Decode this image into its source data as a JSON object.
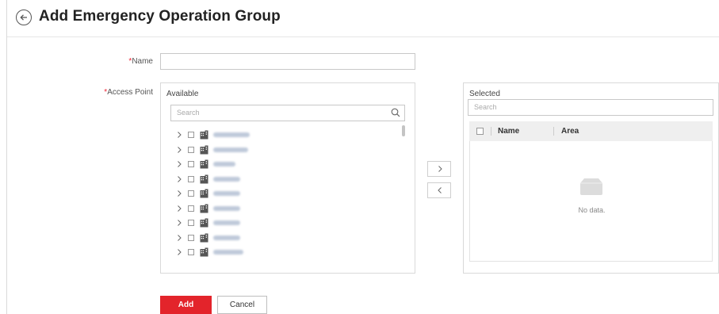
{
  "header": {
    "back_icon": "arrow-left-circle-icon",
    "title": "Add Emergency Operation Group"
  },
  "form": {
    "name_label": "Name",
    "name_value": "",
    "access_point_label": "Access Point",
    "required_mark": "*"
  },
  "available": {
    "title": "Available",
    "search_placeholder": "Search",
    "items": [
      {
        "label_redacted": true
      },
      {
        "label_redacted": true
      },
      {
        "label_redacted": true
      },
      {
        "label_redacted": true
      },
      {
        "label_redacted": true
      },
      {
        "label_redacted": true
      },
      {
        "label_redacted": true
      },
      {
        "label_redacted": true
      },
      {
        "label_redacted": true
      }
    ]
  },
  "transfer": {
    "add_icon": "chevron-right-icon",
    "remove_icon": "chevron-left-icon"
  },
  "selected": {
    "title": "Selected",
    "search_placeholder": "Search",
    "columns": [
      "Name",
      "Area"
    ],
    "empty_text": "No data."
  },
  "actions": {
    "add_label": "Add",
    "cancel_label": "Cancel"
  },
  "colors": {
    "accent": "#e3242b",
    "required": "#e23"
  }
}
